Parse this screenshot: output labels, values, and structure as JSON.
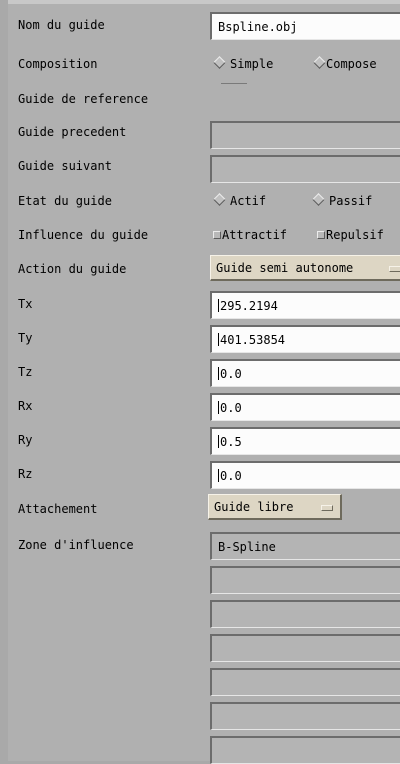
{
  "labels": {
    "nom": "Nom du guide",
    "composition": "Composition",
    "reference": "Guide de reference",
    "precedent": "Guide precedent",
    "suivant": "Guide suivant",
    "etat": "Etat du guide",
    "influence": "Influence du guide",
    "action": "Action du guide",
    "tx": "Tx",
    "ty": "Ty",
    "tz": "Tz",
    "rx": "Rx",
    "ry": "Ry",
    "rz": "Rz",
    "attachement": "Attachement",
    "zone": "Zone d'influence"
  },
  "fields": {
    "nom": "Bspline.obj",
    "precedent": "",
    "suivant": "",
    "tx": "295.2194",
    "ty": "401.53854",
    "tz": "0.0",
    "rx": "0.0",
    "ry": "0.5",
    "rz": "0.0",
    "zone_items": [
      "B-Spline",
      "",
      "",
      "",
      "",
      "",
      ""
    ]
  },
  "composition": {
    "option1": "Simple",
    "option2": "Compose",
    "selected": "Simple"
  },
  "etat": {
    "option1": "Actif",
    "option2": "Passif",
    "selected": "Actif"
  },
  "influence": {
    "option1": "Attractif",
    "option2": "Repulsif",
    "checked1": true,
    "checked2": false
  },
  "action_menu": {
    "value": "Guide semi autonome"
  },
  "attachement_menu": {
    "value": "Guide libre"
  }
}
